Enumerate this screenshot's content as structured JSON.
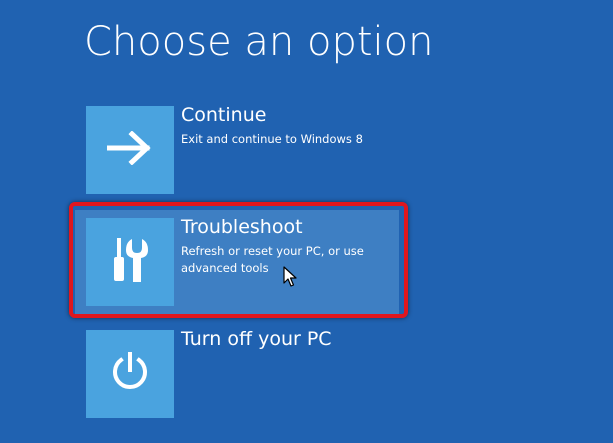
{
  "page": {
    "title": "Choose an option",
    "background_color": "#2062b1",
    "tile_color": "#4aa3df",
    "highlight_color": "#3e7fc3",
    "callout_color": "#e0161e"
  },
  "options": [
    {
      "label": "Continue",
      "description": "Exit and continue to Windows 8",
      "icon": "arrow-right-icon"
    },
    {
      "label": "Troubleshoot",
      "description": "Refresh or reset your PC, or use advanced tools",
      "icon": "tools-icon",
      "selected": true
    },
    {
      "label": "Turn off your PC",
      "description": "",
      "icon": "power-icon"
    }
  ]
}
